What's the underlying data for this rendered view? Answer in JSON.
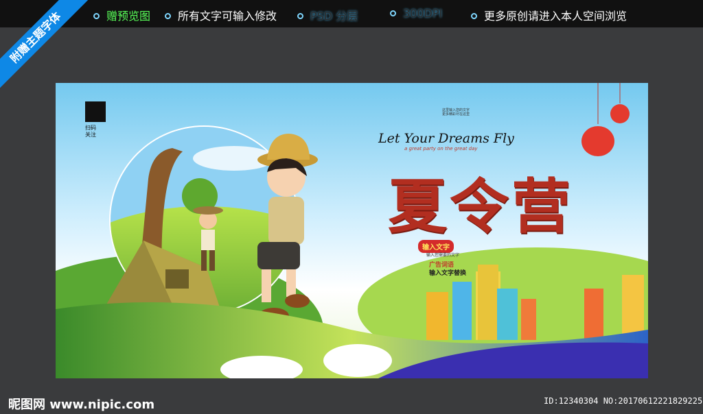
{
  "topbar": {
    "items": [
      {
        "label": "赠预览图"
      },
      {
        "label": "所有文字可输入修改"
      },
      {
        "label": "PSD 分层"
      },
      {
        "label": "300DPI"
      },
      {
        "label": "更多原创请进入本人空间浏览"
      }
    ]
  },
  "ribbon": {
    "label": "附赠主题字体"
  },
  "poster": {
    "qr_caption": [
      "扫码",
      "关注"
    ],
    "tiny_text": [
      "这里输入您的文字",
      "更多精彩尽在这里"
    ],
    "slogan": "Let Your Dreams Fly",
    "slogan_sub": "a great party on the great day",
    "title": "夏令营",
    "badge": "输入文字",
    "ad_small": "输入您需要的文字",
    "ad_title": "广告词语",
    "ad_line": "输入文字替换"
  },
  "watermark": {
    "site": "昵图网 www.nipic.com",
    "id": "ID:12340304 NO:20170612221829225032"
  },
  "colors": {
    "title": "#b22e20",
    "topbar_green": "#59ff59",
    "ribbon": "#0e88e6"
  }
}
